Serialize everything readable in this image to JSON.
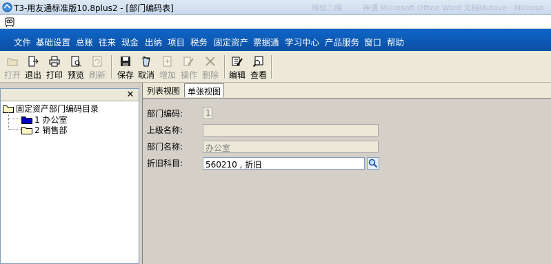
{
  "window": {
    "title": "T3-用友通标准版10.8plus2 - [部门编码表]",
    "ghost_text_1": "微软二维",
    "ghost_text_2": "神通 Microsoft Office Word 文档Mutave · Microso"
  },
  "menubar": {
    "items": [
      "文件",
      "基础设置",
      "总账",
      "往来",
      "现金",
      "出纳",
      "项目",
      "税务",
      "固定资产",
      "票据通",
      "学习中心",
      "产品服务",
      "窗口",
      "帮助"
    ]
  },
  "toolbar": {
    "open": "打开",
    "exit": "退出",
    "print": "打印",
    "preview": "预览",
    "refresh": "刷新",
    "save": "保存",
    "cancel": "取消",
    "add": "增加",
    "operate": "操作",
    "delete": "删除",
    "edit": "编辑",
    "view": "查看"
  },
  "left_pane": {
    "close_glyph": "✕",
    "tree": {
      "root": "固定资产部门编码目录",
      "children": [
        "1 办公室",
        "2 销售部"
      ]
    }
  },
  "tabs": {
    "list_view": "列表视图",
    "single_view": "单张视图"
  },
  "form": {
    "dept_code_label": "部门编码:",
    "dept_code_value": "1",
    "parent_name_label": "上级名称:",
    "parent_name_value": "",
    "dept_name_label": "部门名称:",
    "dept_name_value": "办公室",
    "depr_account_label": "折旧科目:",
    "depr_account_value": "560210 , 折旧"
  },
  "colors": {
    "menubar": "#0b5cb8",
    "toolbar": "#ece9d8",
    "panel": "#d4d0c8"
  }
}
